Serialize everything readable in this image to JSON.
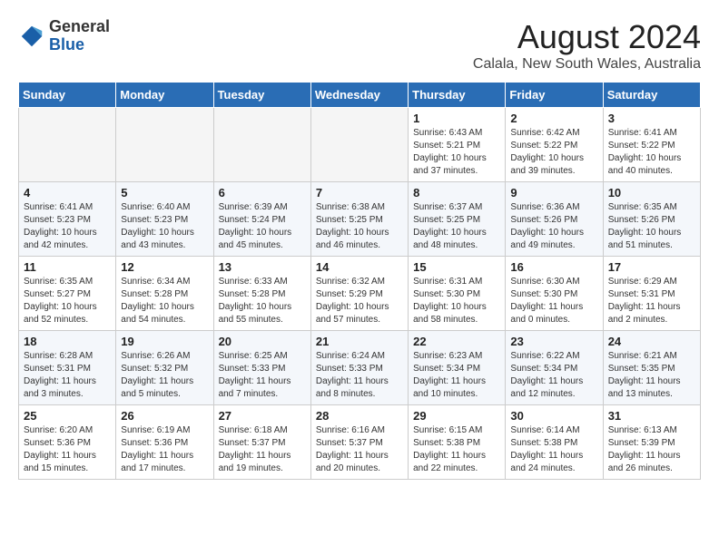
{
  "header": {
    "logo_general": "General",
    "logo_blue": "Blue",
    "title": "August 2024",
    "subtitle": "Calala, New South Wales, Australia"
  },
  "days_of_week": [
    "Sunday",
    "Monday",
    "Tuesday",
    "Wednesday",
    "Thursday",
    "Friday",
    "Saturday"
  ],
  "weeks": [
    [
      {
        "day": "",
        "info": ""
      },
      {
        "day": "",
        "info": ""
      },
      {
        "day": "",
        "info": ""
      },
      {
        "day": "",
        "info": ""
      },
      {
        "day": "1",
        "info": "Sunrise: 6:43 AM\nSunset: 5:21 PM\nDaylight: 10 hours\nand 37 minutes."
      },
      {
        "day": "2",
        "info": "Sunrise: 6:42 AM\nSunset: 5:22 PM\nDaylight: 10 hours\nand 39 minutes."
      },
      {
        "day": "3",
        "info": "Sunrise: 6:41 AM\nSunset: 5:22 PM\nDaylight: 10 hours\nand 40 minutes."
      }
    ],
    [
      {
        "day": "4",
        "info": "Sunrise: 6:41 AM\nSunset: 5:23 PM\nDaylight: 10 hours\nand 42 minutes."
      },
      {
        "day": "5",
        "info": "Sunrise: 6:40 AM\nSunset: 5:23 PM\nDaylight: 10 hours\nand 43 minutes."
      },
      {
        "day": "6",
        "info": "Sunrise: 6:39 AM\nSunset: 5:24 PM\nDaylight: 10 hours\nand 45 minutes."
      },
      {
        "day": "7",
        "info": "Sunrise: 6:38 AM\nSunset: 5:25 PM\nDaylight: 10 hours\nand 46 minutes."
      },
      {
        "day": "8",
        "info": "Sunrise: 6:37 AM\nSunset: 5:25 PM\nDaylight: 10 hours\nand 48 minutes."
      },
      {
        "day": "9",
        "info": "Sunrise: 6:36 AM\nSunset: 5:26 PM\nDaylight: 10 hours\nand 49 minutes."
      },
      {
        "day": "10",
        "info": "Sunrise: 6:35 AM\nSunset: 5:26 PM\nDaylight: 10 hours\nand 51 minutes."
      }
    ],
    [
      {
        "day": "11",
        "info": "Sunrise: 6:35 AM\nSunset: 5:27 PM\nDaylight: 10 hours\nand 52 minutes."
      },
      {
        "day": "12",
        "info": "Sunrise: 6:34 AM\nSunset: 5:28 PM\nDaylight: 10 hours\nand 54 minutes."
      },
      {
        "day": "13",
        "info": "Sunrise: 6:33 AM\nSunset: 5:28 PM\nDaylight: 10 hours\nand 55 minutes."
      },
      {
        "day": "14",
        "info": "Sunrise: 6:32 AM\nSunset: 5:29 PM\nDaylight: 10 hours\nand 57 minutes."
      },
      {
        "day": "15",
        "info": "Sunrise: 6:31 AM\nSunset: 5:30 PM\nDaylight: 10 hours\nand 58 minutes."
      },
      {
        "day": "16",
        "info": "Sunrise: 6:30 AM\nSunset: 5:30 PM\nDaylight: 11 hours\nand 0 minutes."
      },
      {
        "day": "17",
        "info": "Sunrise: 6:29 AM\nSunset: 5:31 PM\nDaylight: 11 hours\nand 2 minutes."
      }
    ],
    [
      {
        "day": "18",
        "info": "Sunrise: 6:28 AM\nSunset: 5:31 PM\nDaylight: 11 hours\nand 3 minutes."
      },
      {
        "day": "19",
        "info": "Sunrise: 6:26 AM\nSunset: 5:32 PM\nDaylight: 11 hours\nand 5 minutes."
      },
      {
        "day": "20",
        "info": "Sunrise: 6:25 AM\nSunset: 5:33 PM\nDaylight: 11 hours\nand 7 minutes."
      },
      {
        "day": "21",
        "info": "Sunrise: 6:24 AM\nSunset: 5:33 PM\nDaylight: 11 hours\nand 8 minutes."
      },
      {
        "day": "22",
        "info": "Sunrise: 6:23 AM\nSunset: 5:34 PM\nDaylight: 11 hours\nand 10 minutes."
      },
      {
        "day": "23",
        "info": "Sunrise: 6:22 AM\nSunset: 5:34 PM\nDaylight: 11 hours\nand 12 minutes."
      },
      {
        "day": "24",
        "info": "Sunrise: 6:21 AM\nSunset: 5:35 PM\nDaylight: 11 hours\nand 13 minutes."
      }
    ],
    [
      {
        "day": "25",
        "info": "Sunrise: 6:20 AM\nSunset: 5:36 PM\nDaylight: 11 hours\nand 15 minutes."
      },
      {
        "day": "26",
        "info": "Sunrise: 6:19 AM\nSunset: 5:36 PM\nDaylight: 11 hours\nand 17 minutes."
      },
      {
        "day": "27",
        "info": "Sunrise: 6:18 AM\nSunset: 5:37 PM\nDaylight: 11 hours\nand 19 minutes."
      },
      {
        "day": "28",
        "info": "Sunrise: 6:16 AM\nSunset: 5:37 PM\nDaylight: 11 hours\nand 20 minutes."
      },
      {
        "day": "29",
        "info": "Sunrise: 6:15 AM\nSunset: 5:38 PM\nDaylight: 11 hours\nand 22 minutes."
      },
      {
        "day": "30",
        "info": "Sunrise: 6:14 AM\nSunset: 5:38 PM\nDaylight: 11 hours\nand 24 minutes."
      },
      {
        "day": "31",
        "info": "Sunrise: 6:13 AM\nSunset: 5:39 PM\nDaylight: 11 hours\nand 26 minutes."
      }
    ]
  ]
}
